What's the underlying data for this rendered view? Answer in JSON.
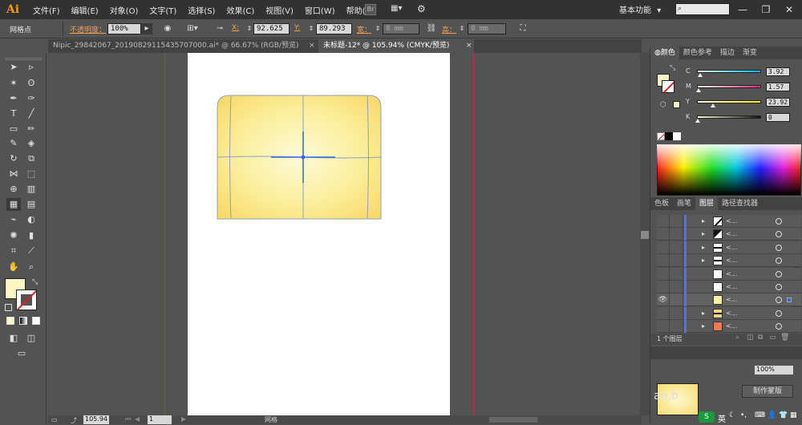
{
  "app": {
    "logo": "Ai",
    "workspace": "基本功能"
  },
  "menu": [
    "文件(F)",
    "编辑(E)",
    "对象(O)",
    "文字(T)",
    "选择(S)",
    "效果(C)",
    "视图(V)",
    "窗口(W)",
    "帮助(H)"
  ],
  "window_controls": {
    "minimize": "—",
    "restore": "❐",
    "close": "✕"
  },
  "control": {
    "tool_label": "网格点",
    "opacity_label": "不透明度：",
    "opacity_value": "100%",
    "x_label": "X:",
    "x_value": "92.625",
    "y_label": "Y:",
    "y_value": "89.293",
    "w_label": "宽：",
    "w_value": "0 mm",
    "h_label": "高：",
    "h_value": "0 mm"
  },
  "tabs": [
    {
      "label": "Nipic_29842067_20190829115435707000.ai* @ 66.67% (RGB/预览)",
      "active": false,
      "close": "×"
    },
    {
      "label": "未标题-12* @ 105.94% (CMYK/预览)",
      "active": true,
      "close": "×"
    }
  ],
  "statusbar": {
    "zoom": "105.94",
    "page": "1",
    "tool": "网格"
  },
  "color_panel": {
    "tabs": [
      "颜色",
      "颜色参考",
      "描边",
      "渐变"
    ],
    "active_tab": 0,
    "channels": [
      {
        "name": "C",
        "value": "3.92",
        "track": "#e8fcfc",
        "end": "#00b7eb",
        "level": 0.0392
      },
      {
        "name": "M",
        "value": "1.57",
        "track": "#fffae0",
        "end": "#ff2a8a",
        "level": 0.0157
      },
      {
        "name": "Y",
        "value": "23.92",
        "track": "#fcf9f0",
        "end": "#ffef00",
        "level": 0.2392
      },
      {
        "name": "K",
        "value": "0",
        "track": "#ffffd8",
        "end": "#101010",
        "level": 0.0
      }
    ],
    "fill_color": "#fbf6c4"
  },
  "layers_panel": {
    "tabs": [
      "色板",
      "画笔",
      "图层",
      "路径查找器"
    ],
    "active_tab": 2,
    "rows": [
      {
        "name": "<...",
        "thumb": "#ffffff",
        "thumb_style": "diag",
        "visible": false
      },
      {
        "name": "<...",
        "thumb": "#ffffff",
        "thumb_style": "half",
        "visible": false
      },
      {
        "name": "<...",
        "thumb": "#ffffff",
        "thumb_style": "strip",
        "visible": false
      },
      {
        "name": "<...",
        "thumb": "#ffffff",
        "thumb_style": "strip",
        "visible": false
      },
      {
        "name": "<...",
        "thumb": "#ffffff",
        "thumb_style": "plain",
        "visible": false
      },
      {
        "name": "<...",
        "thumb": "#ffffff",
        "thumb_style": "plain",
        "visible": false
      },
      {
        "name": "<...",
        "thumb": "#fbf0a0",
        "thumb_style": "plain",
        "visible": true,
        "selected": true
      },
      {
        "name": "<...",
        "thumb": "#f6d680",
        "thumb_style": "strip",
        "visible": false
      },
      {
        "name": "<...",
        "thumb": "#f07850",
        "thumb_style": "plain",
        "visible": false
      }
    ],
    "footer": "1 个图层"
  },
  "bottom_panel": {
    "zoom_value": "100%",
    "button": "制作蒙版",
    "watermark": "an.b",
    "ime_label": "英"
  }
}
